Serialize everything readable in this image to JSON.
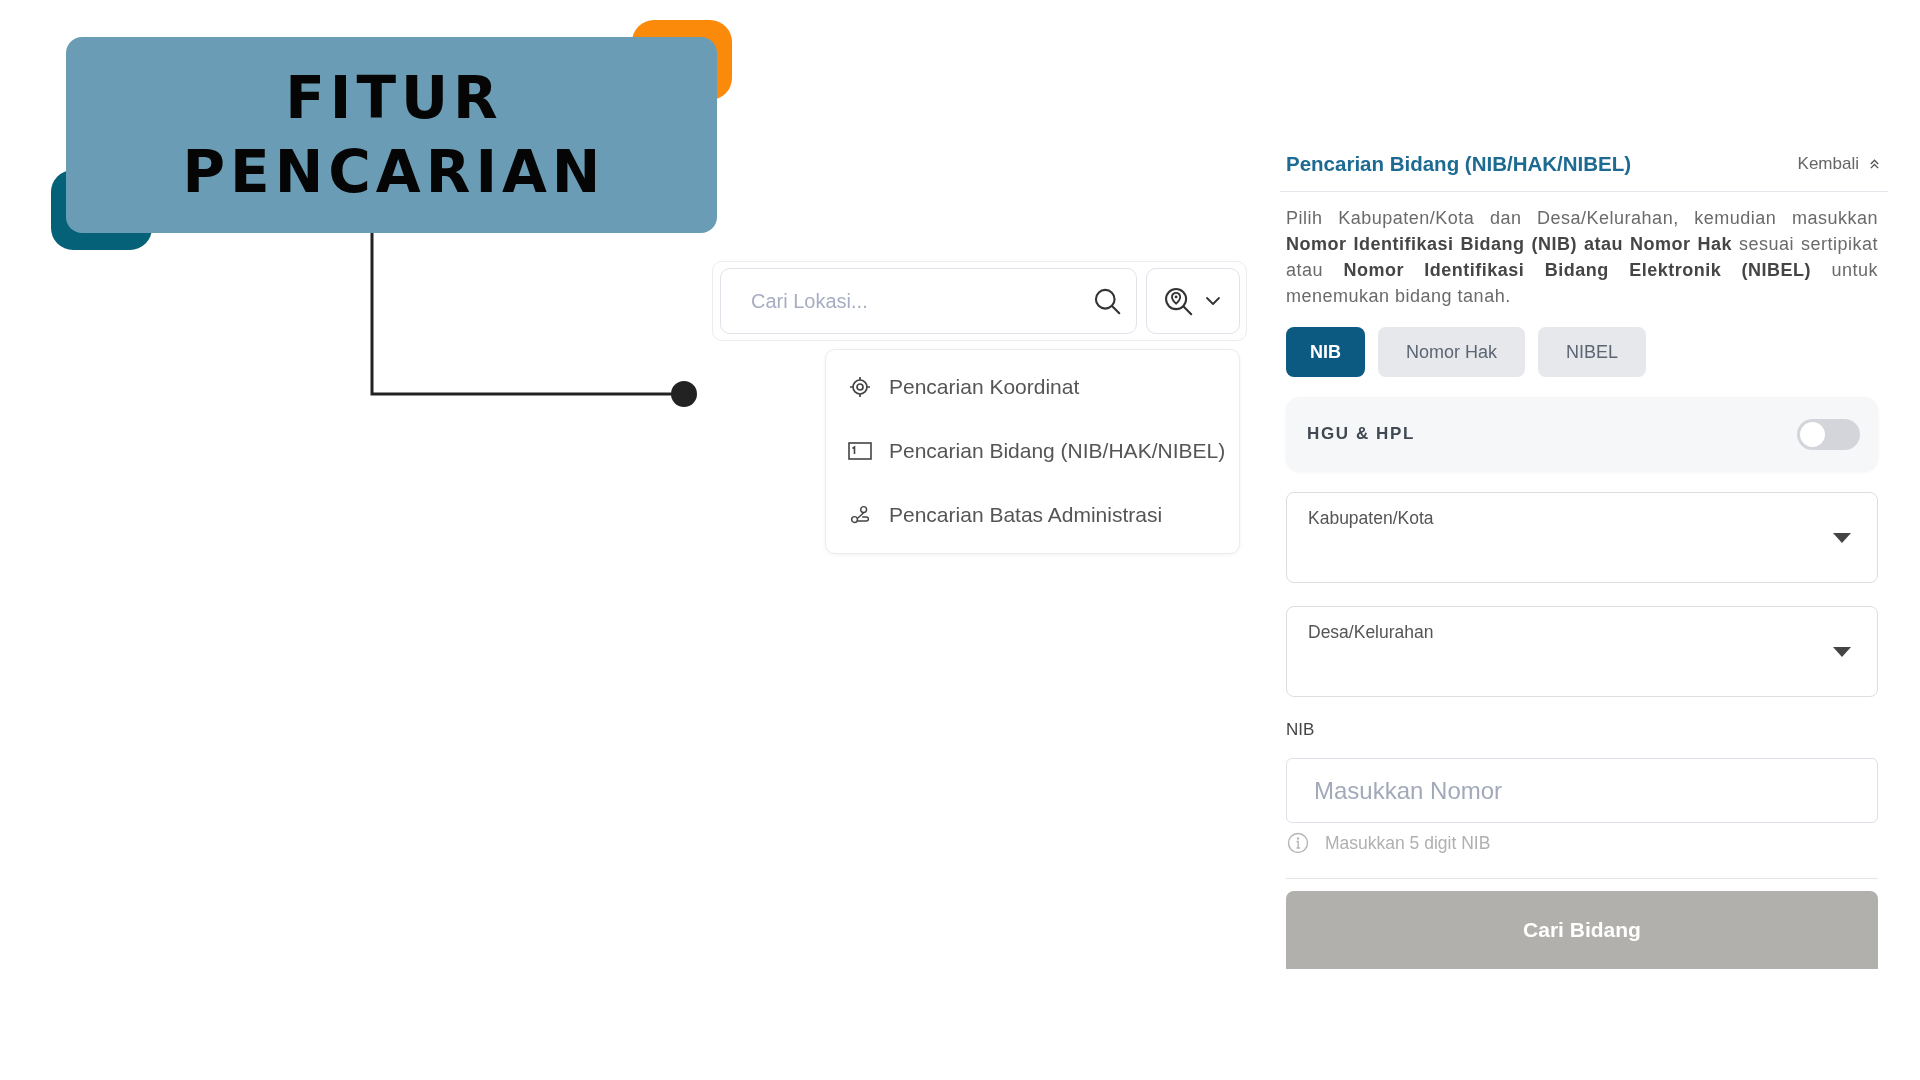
{
  "title_card": {
    "lines": [
      "FITUR",
      "PENCARIAN"
    ]
  },
  "search_bar": {
    "placeholder": "Cari Lokasi..."
  },
  "search_menu": {
    "items": [
      {
        "kind": "coordinate",
        "label": "Pencarian Koordinat"
      },
      {
        "kind": "parcel",
        "label": "Pencarian Bidang (NIB/HAK/NIBEL)"
      },
      {
        "kind": "boundary",
        "label": "Pencarian Batas Administrasi"
      }
    ]
  },
  "panel": {
    "title": "Pencarian Bidang (NIB/HAK/NIBEL)",
    "back_link": "Kembali",
    "description": "Pilih Kabupaten/Kota dan Desa/Kelurahan, kemudian masukkan **Nomor Identifikasi Bidang (NIB) atau Nomor Hak** sesuai sertipikat atau **Nomor Identifikasi Bidang Elektronik (NIBEL)** untuk menemukan bidang tanah.",
    "tabs": [
      {
        "label": "NIB",
        "selected": true
      },
      {
        "label": "Nomor Hak",
        "selected": false
      },
      {
        "label": "NIBEL",
        "selected": false
      }
    ],
    "toggle": {
      "label": "HGU & HPL",
      "on": false
    },
    "dropdowns": [
      {
        "label": "Kabupaten/Kota"
      },
      {
        "label": "Desa/Kelurahan"
      }
    ],
    "nib_field": {
      "label": "NIB",
      "placeholder": "Masukkan Nomor",
      "hint": "Masukkan 5 digit NIB"
    },
    "submit_button": {
      "label": "Cari Bidang",
      "disabled": true
    }
  }
}
